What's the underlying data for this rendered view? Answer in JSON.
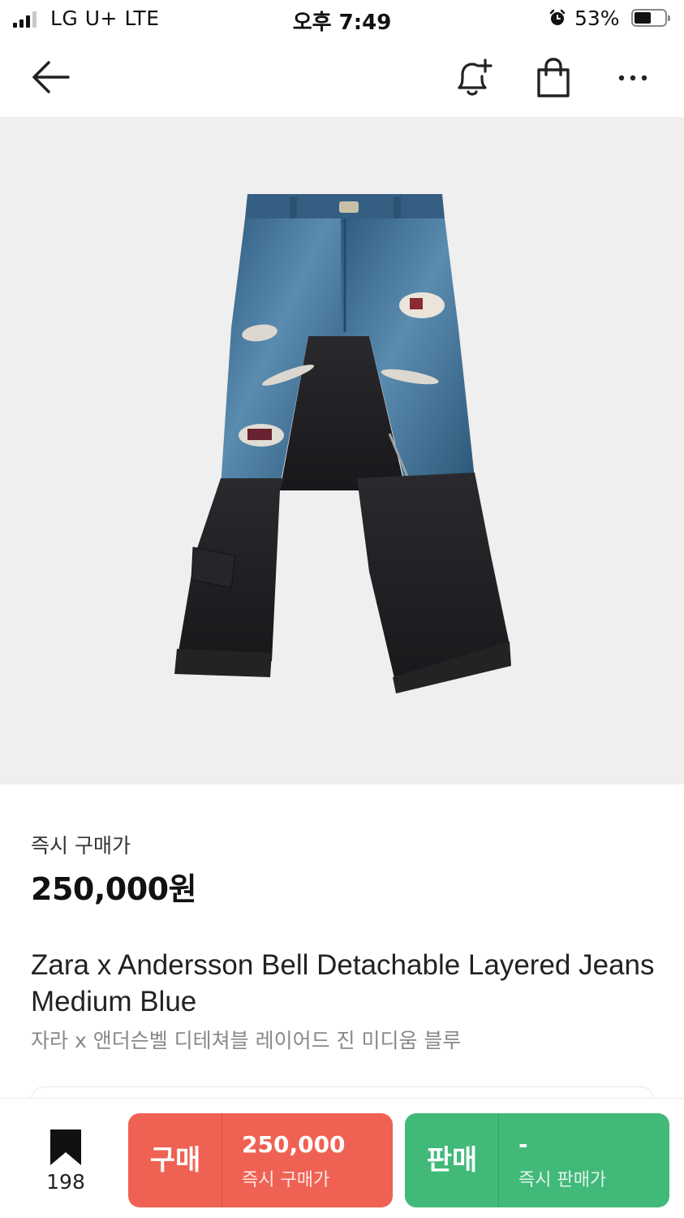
{
  "status_bar": {
    "carrier": "LG U+  LTE",
    "time": "오후 7:49",
    "battery": "53%"
  },
  "nav": {
    "icons": [
      "back-arrow-icon",
      "bell-plus-icon",
      "shopping-bag-icon",
      "more-icon"
    ]
  },
  "product": {
    "price_label": "즉시 구매가",
    "price": "250,000원",
    "name_en": "Zara x Andersson Bell Detachable Layered Jeans Medium Blue",
    "name_ko": "자라 x 앤더슨벨 디테쳐블 레이어드 진 미디움 블루"
  },
  "bottom_bar": {
    "wish_count": "198",
    "buy": {
      "label": "구매",
      "amount": "250,000",
      "sub": "즉시 구매가",
      "color": "#ef6253"
    },
    "sell": {
      "label": "판매",
      "amount": "-",
      "sub": "즉시 판매가",
      "color": "#41b979"
    }
  },
  "colors": {
    "image_bg": "#efefef",
    "denim_blue": "#3b6e93",
    "black_denim": "#1f1f22"
  }
}
